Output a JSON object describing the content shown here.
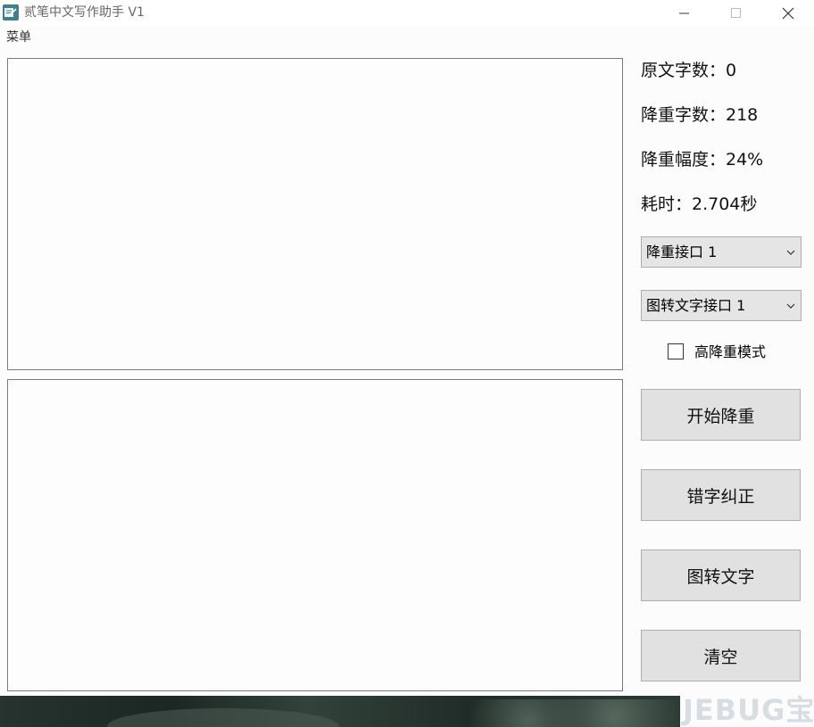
{
  "window": {
    "title": "贰笔中文写作助手 V1",
    "icons": {
      "app": "notebook-pen-icon",
      "minimize": "minimize-icon",
      "maximize": "maximize-icon",
      "close": "close-icon"
    }
  },
  "menu": {
    "label": "菜单"
  },
  "editor": {
    "source_text": "",
    "result_text": ""
  },
  "stats": {
    "original_count": "原文字数：0",
    "reduced_count": "降重字数：218",
    "reduction_rate": "降重幅度：24%",
    "time_used": "耗时：2.704秒"
  },
  "controls": {
    "reduce_api": "降重接口 1",
    "ocr_api": "图转文字接口 1",
    "high_mode_label": "高降重模式",
    "high_mode_checked": false
  },
  "buttons": {
    "start": "开始降重",
    "correct": "错字纠正",
    "ocr": "图转文字",
    "clear": "清空"
  },
  "watermark": {
    "text": "JEBUG",
    "suffix": "宝"
  },
  "colors": {
    "background": "#fcfcfc",
    "button": "#e1e1e1",
    "border": "#adadad",
    "icon_accent": "#3f7f8f"
  }
}
